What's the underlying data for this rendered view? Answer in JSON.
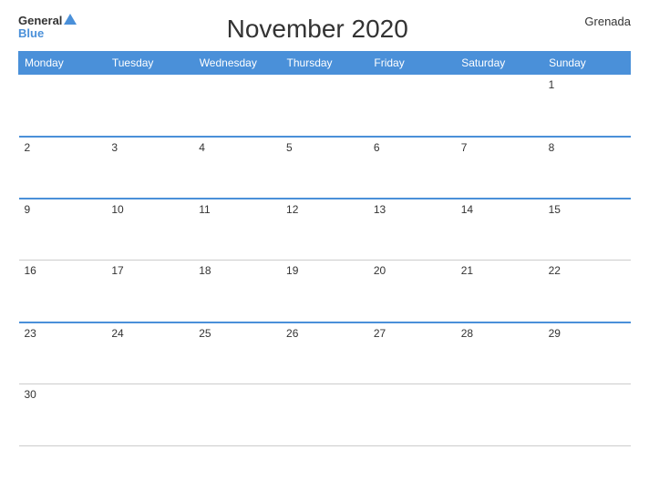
{
  "header": {
    "logo_general": "General",
    "logo_blue": "Blue",
    "title": "November 2020",
    "country": "Grenada"
  },
  "days_of_week": [
    "Monday",
    "Tuesday",
    "Wednesday",
    "Thursday",
    "Friday",
    "Saturday",
    "Sunday"
  ],
  "weeks": [
    [
      null,
      null,
      null,
      null,
      null,
      null,
      1
    ],
    [
      2,
      3,
      4,
      5,
      6,
      7,
      8
    ],
    [
      9,
      10,
      11,
      12,
      13,
      14,
      15
    ],
    [
      16,
      17,
      18,
      19,
      20,
      21,
      22
    ],
    [
      23,
      24,
      25,
      26,
      27,
      28,
      29
    ],
    [
      30,
      null,
      null,
      null,
      null,
      null,
      null
    ]
  ],
  "blue_row_indices": [
    1,
    2,
    4
  ]
}
